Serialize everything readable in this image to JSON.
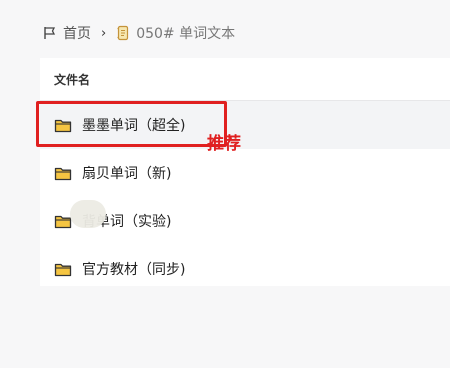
{
  "breadcrumb": {
    "home": "首页",
    "separator": "›",
    "current": "050# 单词文本"
  },
  "table": {
    "column_header": "文件名",
    "rows": [
      {
        "label": "墨墨单词（超全)"
      },
      {
        "label": "扇贝单词（新)"
      },
      {
        "label": "背单词（实验)"
      },
      {
        "label": "官方教材（同步)"
      }
    ]
  },
  "annotation": "推荐",
  "colors": {
    "highlight_box": "#e02020",
    "folder_fill": "#f5c542",
    "folder_stroke": "#333333"
  }
}
